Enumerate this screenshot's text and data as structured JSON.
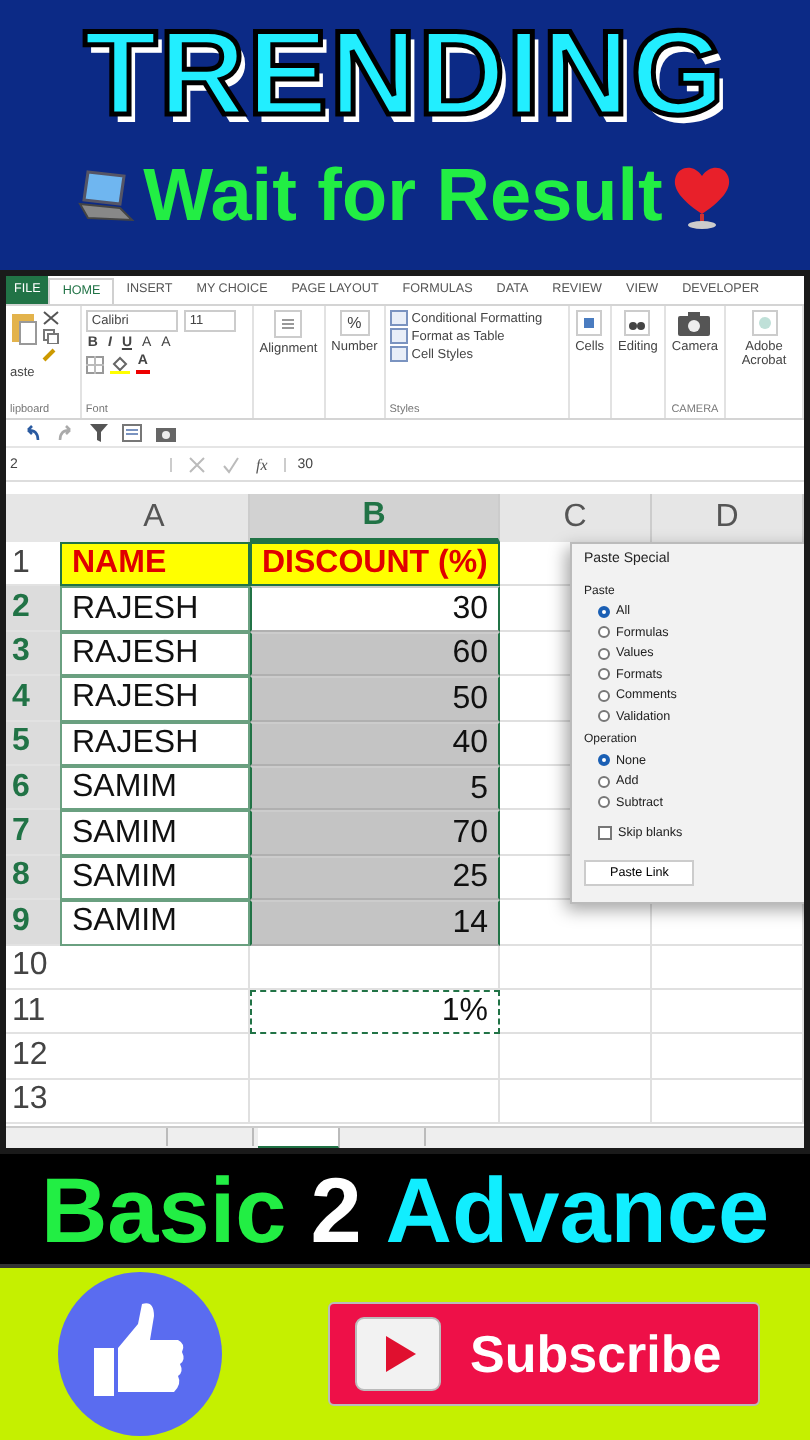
{
  "header": {
    "title": "TRENDING",
    "subtitle": "Wait for Result"
  },
  "excel": {
    "ribbon_tabs": [
      {
        "label": "FILE",
        "selected": false,
        "kind": "file"
      },
      {
        "label": "HOME",
        "selected": true,
        "kind": "tab"
      },
      {
        "label": "INSERT",
        "selected": false,
        "kind": "tab"
      },
      {
        "label": "MY CHOICE",
        "selected": false,
        "kind": "tab"
      },
      {
        "label": "PAGE LAYOUT",
        "selected": false,
        "kind": "tab"
      },
      {
        "label": "FORMULAS",
        "selected": false,
        "kind": "tab"
      },
      {
        "label": "DATA",
        "selected": false,
        "kind": "tab"
      },
      {
        "label": "REVIEW",
        "selected": false,
        "kind": "tab"
      },
      {
        "label": "VIEW",
        "selected": false,
        "kind": "tab"
      },
      {
        "label": "DEVELOPER",
        "selected": false,
        "kind": "tab"
      }
    ],
    "ribbon": {
      "paste_label": "aste",
      "clipboard_group": "lipboard",
      "font_name": "Calibri",
      "font_size": "11",
      "format_buttons": [
        "B",
        "I",
        "U"
      ],
      "grow_labels": [
        "A",
        "A"
      ],
      "font_color_label": "A",
      "font_group": "Font",
      "alignment": "Alignment",
      "number": "Number",
      "number_symbol": "%",
      "styles": [
        "Conditional Formatting",
        "Format as Table",
        "Cell Styles"
      ],
      "styles_group": "Styles",
      "cells": "Cells",
      "editing": "Editing",
      "camera": "Camera",
      "camera_group": "CAMERA",
      "acrobat": "Adobe Acrobat"
    },
    "name_box": "2",
    "fx_label": "fx",
    "formula": "30",
    "columns": [
      {
        "label": "A",
        "selected": false
      },
      {
        "label": "B",
        "selected": true
      },
      {
        "label": "C",
        "selected": false
      },
      {
        "label": "D",
        "selected": false
      }
    ],
    "rows": [
      {
        "num": "1",
        "kind": "header",
        "name": "NAME",
        "discount": "DISCOUNT (%)",
        "selected": false,
        "active": false,
        "copied": false
      },
      {
        "num": "2",
        "kind": "data",
        "name": "RAJESH",
        "discount": "30",
        "selected": true,
        "active": true,
        "copied": false
      },
      {
        "num": "3",
        "kind": "data",
        "name": "RAJESH",
        "discount": "60",
        "selected": true,
        "active": false,
        "copied": false
      },
      {
        "num": "4",
        "kind": "data",
        "name": "RAJESH",
        "discount": "50",
        "selected": true,
        "active": false,
        "copied": false
      },
      {
        "num": "5",
        "kind": "data",
        "name": "RAJESH",
        "discount": "40",
        "selected": true,
        "active": false,
        "copied": false
      },
      {
        "num": "6",
        "kind": "data",
        "name": "SAMIM",
        "discount": "5",
        "selected": true,
        "active": false,
        "copied": false
      },
      {
        "num": "7",
        "kind": "data",
        "name": "SAMIM",
        "discount": "70",
        "selected": true,
        "active": false,
        "copied": false
      },
      {
        "num": "8",
        "kind": "data",
        "name": "SAMIM",
        "discount": "25",
        "selected": true,
        "active": false,
        "copied": false
      },
      {
        "num": "9",
        "kind": "data",
        "name": "SAMIM",
        "discount": "14",
        "selected": true,
        "active": false,
        "copied": false
      },
      {
        "num": "10",
        "kind": "data",
        "selected": false,
        "active": false,
        "copied": false
      },
      {
        "num": "11",
        "kind": "data",
        "discount": "1%",
        "selected": false,
        "active": false,
        "copied": true
      },
      {
        "num": "12",
        "kind": "data",
        "selected": false,
        "active": false,
        "copied": false
      },
      {
        "num": "13",
        "kind": "data",
        "selected": false,
        "active": false,
        "copied": false
      }
    ],
    "dialog": {
      "title": "Paste Special",
      "paste_heading": "Paste",
      "paste_options": [
        {
          "label": "All",
          "selected": true
        },
        {
          "label": "Formulas",
          "selected": false
        },
        {
          "label": "Values",
          "selected": false
        },
        {
          "label": "Formats",
          "selected": false
        },
        {
          "label": "Comments",
          "selected": false
        },
        {
          "label": "Validation",
          "selected": false
        }
      ],
      "operation_heading": "Operation",
      "operation_options": [
        {
          "label": "None",
          "selected": true
        },
        {
          "label": "Add",
          "selected": false
        },
        {
          "label": "Subtract",
          "selected": false
        }
      ],
      "skip_blanks": {
        "label": "Skip blanks",
        "checked": false
      },
      "button": "Paste Link"
    },
    "sheet_tabs": [
      {
        "selected": false
      },
      {
        "selected": false
      },
      {
        "selected": true
      },
      {
        "selected": false
      }
    ]
  },
  "banner": [
    {
      "text": "Basic",
      "color": "#22ee44"
    },
    {
      "text": "2",
      "color": "#ffffff"
    },
    {
      "text": "Advance",
      "color": "#11eeff"
    }
  ],
  "subscribe": "Subscribe"
}
